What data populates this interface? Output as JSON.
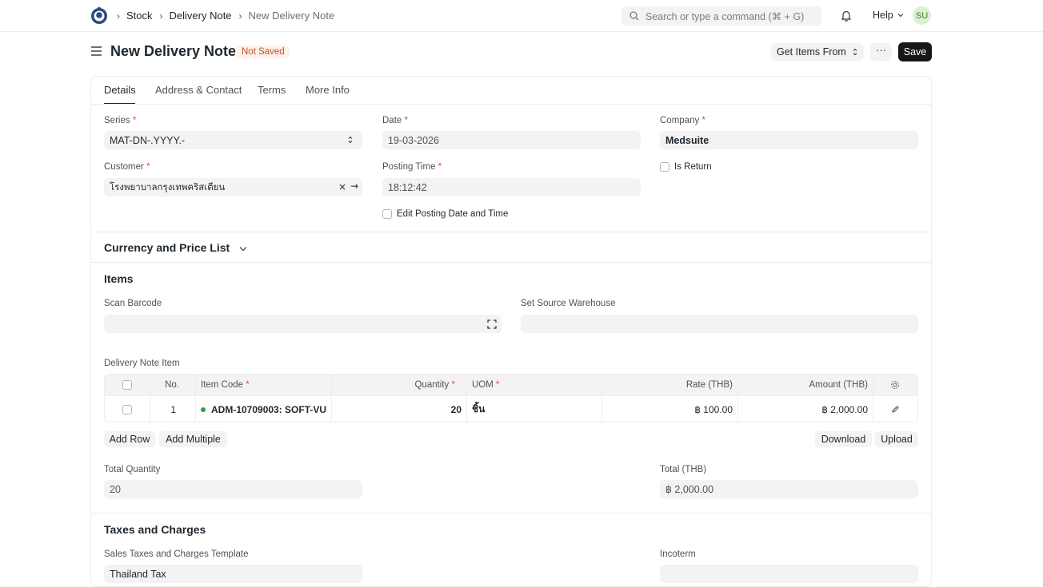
{
  "navbar": {
    "breadcrumbs": [
      "Stock",
      "Delivery Note",
      "New Delivery Note"
    ],
    "search_placeholder": "Search or type a command (⌘ + G)",
    "help_label": "Help",
    "avatar_initials": "SU"
  },
  "page": {
    "title": "New Delivery Note",
    "status_badge": "Not Saved",
    "get_items_label": "Get Items From",
    "more_label": "···",
    "save_label": "Save"
  },
  "tabs": [
    "Details",
    "Address & Contact",
    "Terms",
    "More Info"
  ],
  "details": {
    "series_label": "Series",
    "series_value": "MAT-DN-.YYYY.-",
    "date_label": "Date",
    "date_value": "19-03-2026",
    "company_label": "Company",
    "company_value": "Medsuite",
    "customer_label": "Customer",
    "customer_value": "โรงพยาบาลกรุงเทพคริสเตียน",
    "posting_time_label": "Posting Time",
    "posting_time_value": "18:12:42",
    "is_return_label": "Is Return",
    "edit_posting_label": "Edit Posting Date and Time"
  },
  "currency_section": {
    "title": "Currency and Price List"
  },
  "items_section": {
    "title": "Items",
    "scan_barcode_label": "Scan Barcode",
    "source_warehouse_label": "Set Source Warehouse",
    "grid_label": "Delivery Note Item",
    "columns": {
      "no": "No.",
      "item_code": "Item Code",
      "quantity": "Quantity",
      "uom": "UOM",
      "rate": "Rate (THB)",
      "amount": "Amount (THB)"
    },
    "rows": [
      {
        "no": "1",
        "item_code": "ADM-10709003: SOFT-VU",
        "quantity": "20",
        "uom": "ชิ้น",
        "rate": "฿ 100.00",
        "amount": "฿ 2,000.00"
      }
    ],
    "add_row_label": "Add Row",
    "add_multiple_label": "Add Multiple",
    "download_label": "Download",
    "upload_label": "Upload",
    "total_quantity_label": "Total Quantity",
    "total_quantity_value": "20",
    "total_label": "Total (THB)",
    "total_value": "฿ 2,000.00"
  },
  "taxes_section": {
    "title": "Taxes and Charges",
    "template_label": "Sales Taxes and Charges Template",
    "template_value": "Thailand Tax",
    "incoterm_label": "Incoterm"
  },
  "colors": {
    "primary_button": "#171717",
    "badge_text": "#c0532a",
    "badge_bg": "#fff1e7",
    "required": "#e24c4c",
    "status_dot": "#2f9d47"
  }
}
